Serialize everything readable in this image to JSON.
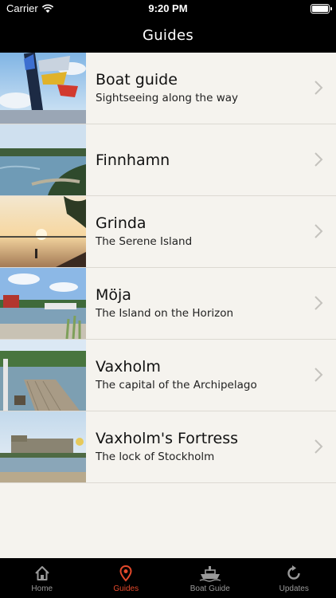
{
  "status": {
    "carrier": "Carrier",
    "time": "9:20 PM"
  },
  "header": {
    "title": "Guides"
  },
  "guides": [
    {
      "title": "Boat guide",
      "subtitle": "Sightseeing along the way"
    },
    {
      "title": "Finnhamn",
      "subtitle": ""
    },
    {
      "title": "Grinda",
      "subtitle": "The Serene Island"
    },
    {
      "title": "Möja",
      "subtitle": "The Island on the Horizon"
    },
    {
      "title": "Vaxholm",
      "subtitle": "The capital of the Archipelago"
    },
    {
      "title": "Vaxholm's Fortress",
      "subtitle": "The lock of Stockholm"
    }
  ],
  "tabbar": {
    "tabs": [
      {
        "label": "Home",
        "icon": "home-icon",
        "active": false
      },
      {
        "label": "Guides",
        "icon": "location-pin-icon",
        "active": true
      },
      {
        "label": "Boat Guide",
        "icon": "boat-icon",
        "active": false
      },
      {
        "label": "Updates",
        "icon": "refresh-icon",
        "active": false
      }
    ],
    "active_color": "#e5492b",
    "inactive_color": "#9a9a9a"
  }
}
